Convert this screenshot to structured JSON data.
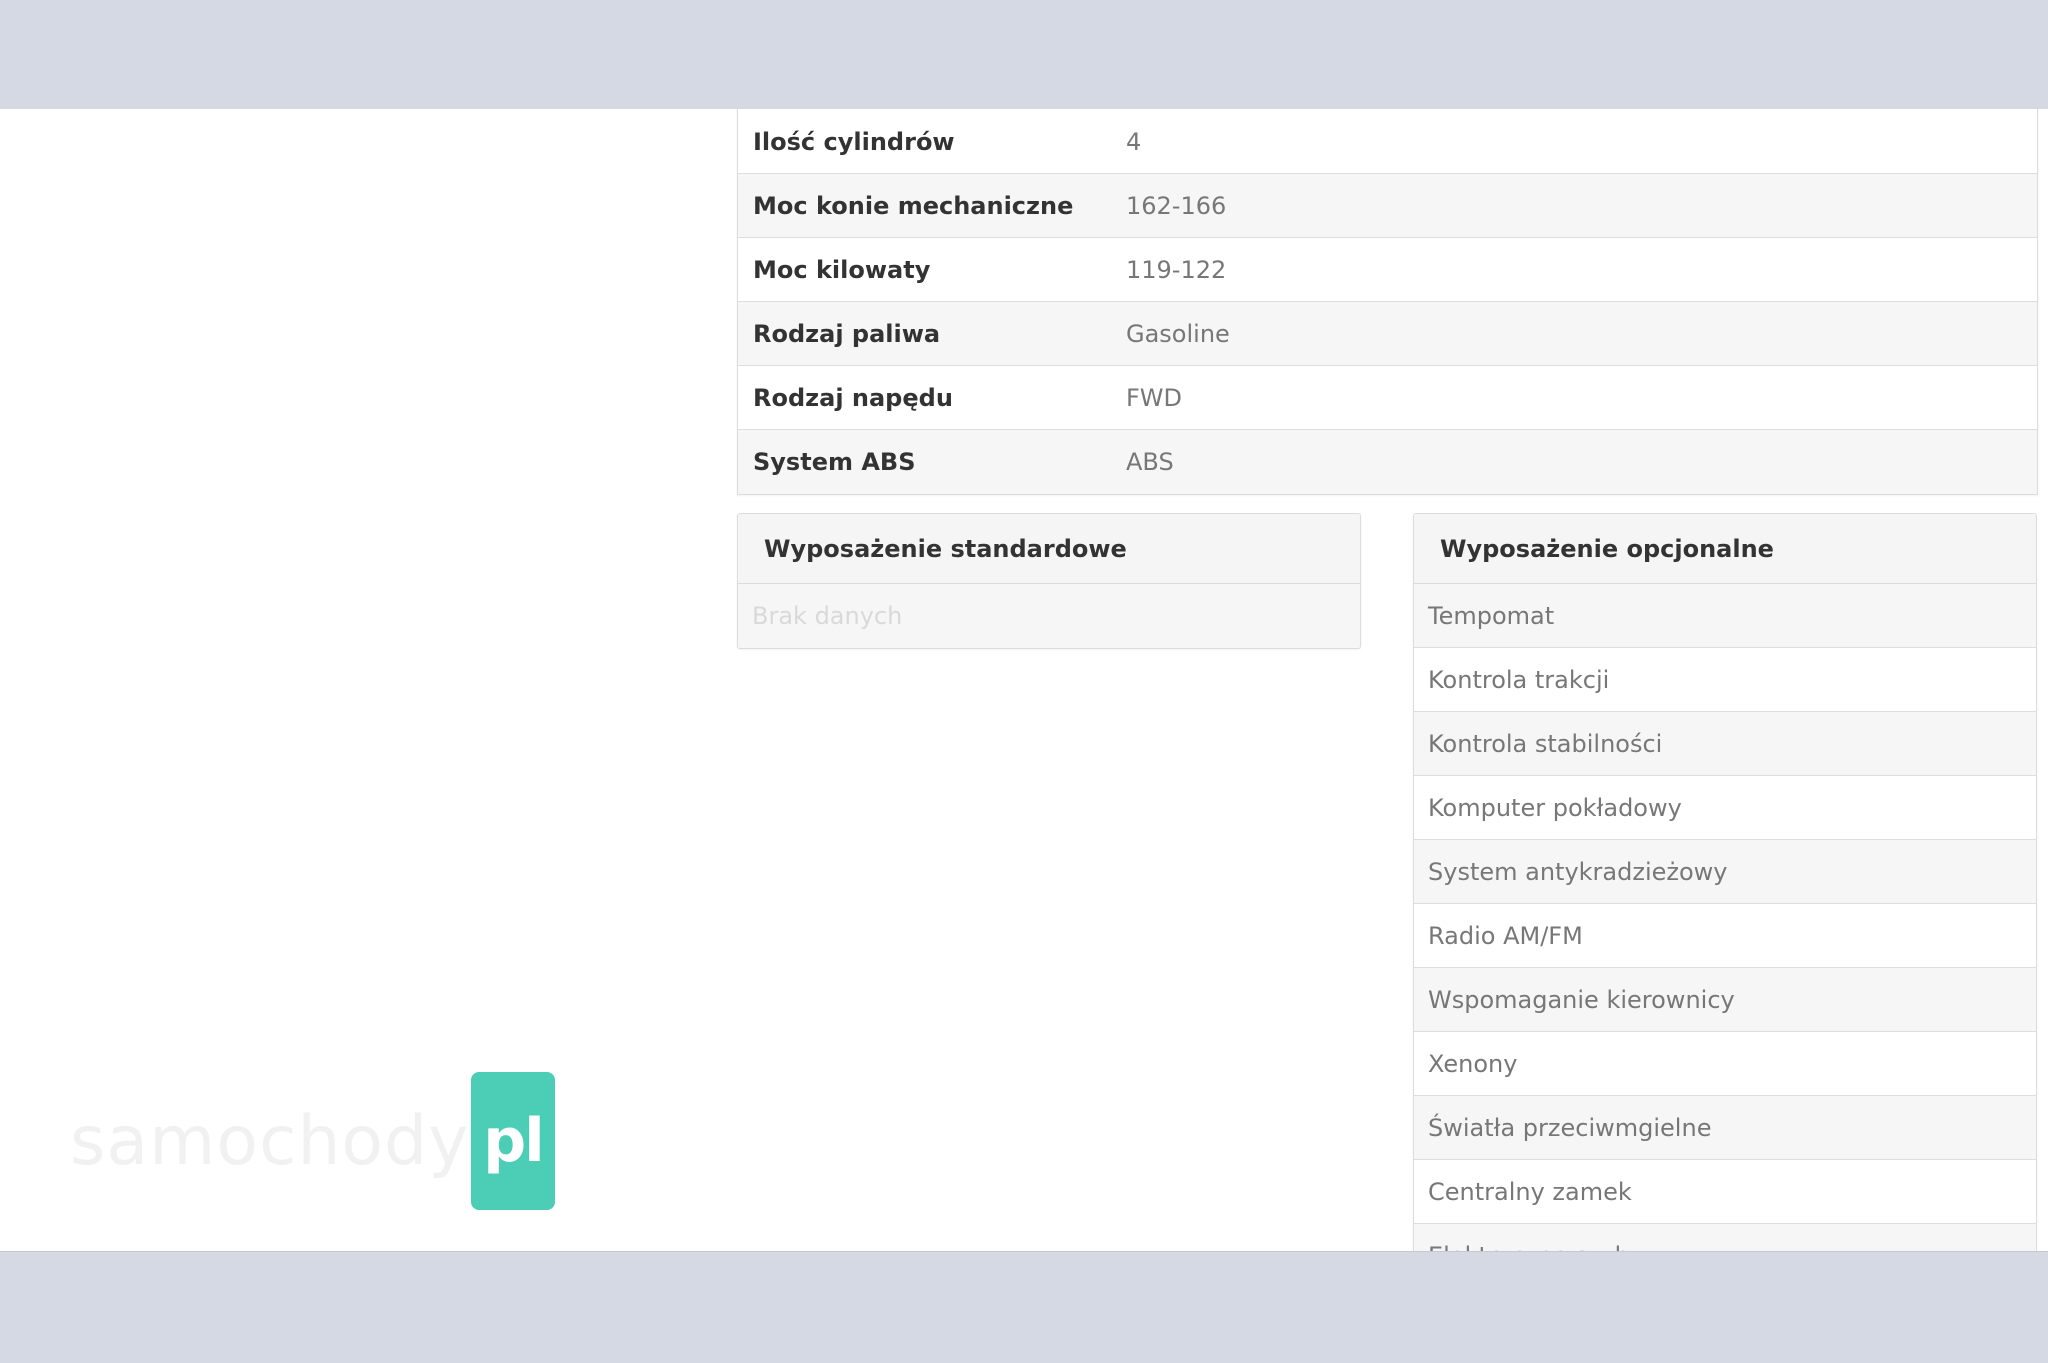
{
  "specs": [
    {
      "label": "Ilość cylindrów",
      "value": "4"
    },
    {
      "label": "Moc konie mechaniczne",
      "value": "162-166"
    },
    {
      "label": "Moc kilowaty",
      "value": "119-122"
    },
    {
      "label": "Rodzaj paliwa",
      "value": "Gasoline"
    },
    {
      "label": "Rodzaj napędu",
      "value": "FWD"
    },
    {
      "label": "System ABS",
      "value": "ABS"
    }
  ],
  "standard_equipment": {
    "title": "Wyposażenie standardowe",
    "empty_text": "Brak danych"
  },
  "optional_equipment": {
    "title": "Wyposażenie opcjonalne",
    "items": [
      "Tempomat",
      "Kontrola trakcji",
      "Kontrola stabilności",
      "Komputer pokładowy",
      "System antykradzieżowy",
      "Radio AM/FM",
      "Wspomaganie kierownicy",
      "Xenony",
      "Światła przeciwmgielne",
      "Centralny zamek",
      "Elektryczne szyby"
    ]
  },
  "logo": {
    "text": "samochody",
    "badge": "pl"
  },
  "colors": {
    "logo_badge": "#4ccdb6",
    "background_band": "#d4d9e4"
  }
}
